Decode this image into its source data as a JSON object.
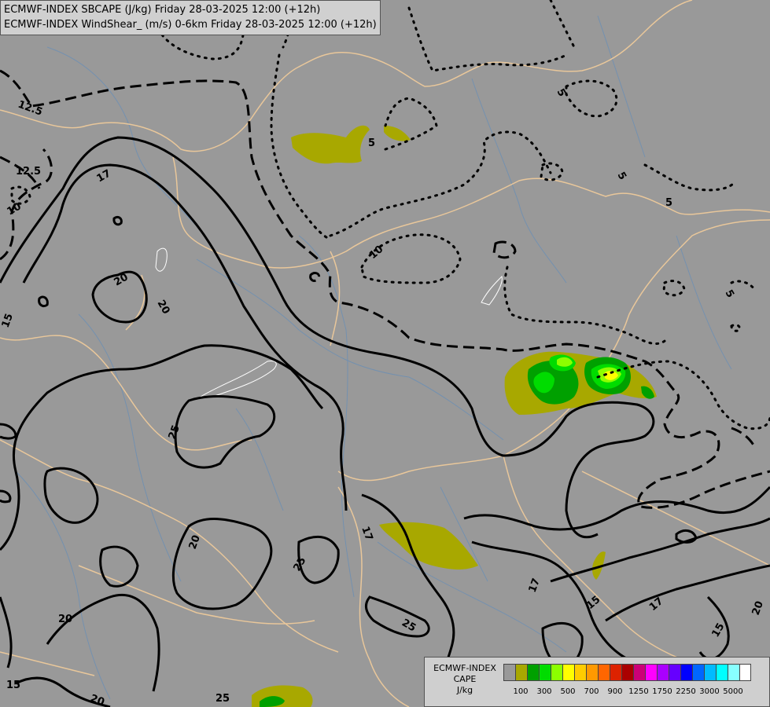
{
  "header": {
    "line1": "ECMWF-INDEX SBCAPE (J/kg) Friday 28-03-2025 12:00 (+12h)",
    "line2": "ECMWF-INDEX WindShear_ (m/s) 0-6km Friday 28-03-2025 12:00 (+12h)"
  },
  "legend": {
    "title_line1": "ECMWF-INDEX",
    "title_line2": "CAPE",
    "units": "J/kg",
    "colors": [
      "#999999",
      "#a8a800",
      "#00a000",
      "#00dc00",
      "#8cff00",
      "#ffff00",
      "#ffcc00",
      "#ff9900",
      "#ff6600",
      "#dd2200",
      "#aa0000",
      "#cc0077",
      "#ff00ff",
      "#aa00ff",
      "#6600ff",
      "#0000ff",
      "#0066ff",
      "#00bbff",
      "#00ffff",
      "#88ffff",
      "#ffffff"
    ],
    "ticks": [
      "100",
      "300",
      "500",
      "700",
      "900",
      "1250",
      "1750",
      "2250",
      "3000",
      "5000"
    ]
  },
  "contour_labels": [
    "12.5",
    "12.5",
    "10",
    "17",
    "20",
    "20",
    "15",
    "25",
    "5",
    "5",
    "5",
    "5",
    "5",
    "10",
    "17",
    "17",
    "20",
    "25",
    "25",
    "15",
    "15",
    "17",
    "20",
    "20",
    "25",
    "15",
    "20",
    "25",
    "15",
    "17",
    "15"
  ]
}
